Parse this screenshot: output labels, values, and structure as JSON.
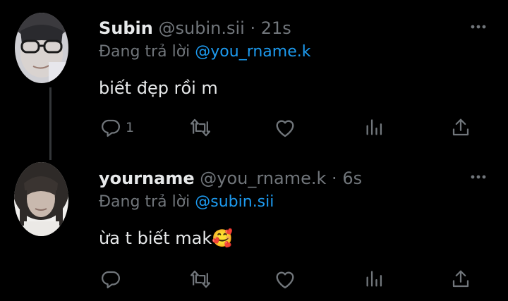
{
  "colors": {
    "background": "#000000",
    "text_primary": "#e7e9ea",
    "text_secondary": "#71767b",
    "accent": "#1d9bf0",
    "thread_line": "#333639"
  },
  "tweets": [
    {
      "display_name": "Subin",
      "handle": "@subin.sii",
      "separator": "·",
      "time": "21s",
      "reply_prefix": "Đang trả lời",
      "reply_to": "@you_rname.k",
      "text": "biết đẹp rồi m",
      "reply_count": "1",
      "icons": [
        "reply-icon",
        "retweet-icon",
        "like-icon",
        "views-icon",
        "share-icon",
        "more-icon"
      ]
    },
    {
      "display_name": "yourname",
      "handle": "@you_rname.k",
      "separator": "·",
      "time": "6s",
      "reply_prefix": "Đang trả lời",
      "reply_to": "@subin.sii",
      "text": "ừa t biết mak",
      "emoji": "🥰",
      "reply_count": "",
      "icons": [
        "reply-icon",
        "retweet-icon",
        "like-icon",
        "views-icon",
        "share-icon",
        "more-icon"
      ]
    }
  ]
}
